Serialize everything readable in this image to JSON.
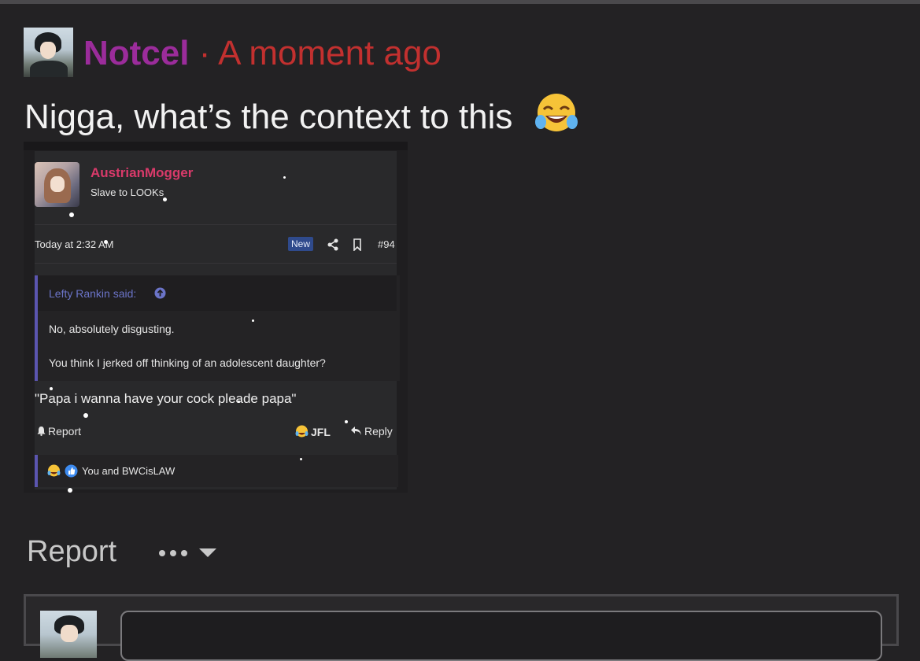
{
  "comment": {
    "author": "Notcel",
    "separator": "·",
    "time": "A moment ago",
    "text": "Nigga, what’s the context to this"
  },
  "embedded_post": {
    "poster_name": "AustrianMogger",
    "poster_title": "Slave to LOOKs",
    "time": "Today at 2:32 AM",
    "badge": "New",
    "post_number": "#94",
    "quote": {
      "attribution": "Lefty Rankin said:",
      "line1": "No, absolutely disgusting.",
      "line2": "You think I jerked off thinking of an adolescent daughter?"
    },
    "body": "\"Papa i wanna have your cock pleade papa\"",
    "actions": {
      "report": "Report",
      "reaction": "JFL",
      "reply": "Reply"
    },
    "reactions_text": "You and BWCisLAW"
  },
  "footer": {
    "report": "Report"
  },
  "icons": {
    "comment_emoji": "face-with-tears-of-joy-icon",
    "share": "share-icon",
    "bookmark": "bookmark-icon",
    "quote_up": "arrow-up-circle-icon",
    "report": "bell-icon",
    "reply": "reply-arrow-icon",
    "more": "ellipsis-icon",
    "dropdown": "caret-down-icon"
  },
  "colors": {
    "author": "#9b2c9b",
    "time": "#c2302f",
    "poster_name": "#d93a6a",
    "quote_accent": "#5b55b0",
    "quote_attribution": "#6b74c8",
    "badge_bg": "#2f4a8c"
  }
}
